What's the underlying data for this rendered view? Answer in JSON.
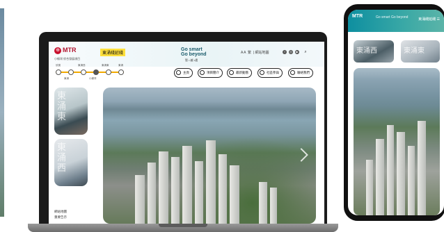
{
  "site": {
    "logo_text": "MTR",
    "logo_subtitle": "小蠔灣 綜合發展項目",
    "brand_name": "東涌綫延綫",
    "campaign_line1": "Go smart",
    "campaign_line2": "Go beyond",
    "campaign_sub": "智 • 越 •遠"
  },
  "utility_nav": {
    "text_size": "A A",
    "language": "繁",
    "search_label": "網站地圖"
  },
  "line_map": {
    "stations_top": [
      "欣澳",
      "東涌西",
      "東涌東",
      "東涌"
    ],
    "stations_bottom": [
      "東涌",
      "小蠔灣"
    ]
  },
  "pills": [
    {
      "label": "主頁"
    },
    {
      "label": "項目簡介"
    },
    {
      "label": "最新動態"
    },
    {
      "label": "社區參與"
    },
    {
      "label": "聯絡我們"
    }
  ],
  "cards": [
    {
      "label": "東涌東"
    },
    {
      "label": "東涌西"
    }
  ],
  "footer": {
    "links": [
      "網站地圖",
      "重要告示"
    ]
  },
  "phone": {
    "logo_text": "MTR",
    "brand_text": "Go smart Go beyond",
    "menu_label": "東涌綫延綫",
    "cards": [
      {
        "label": "東涌西"
      },
      {
        "label": "東涌東"
      }
    ]
  }
}
